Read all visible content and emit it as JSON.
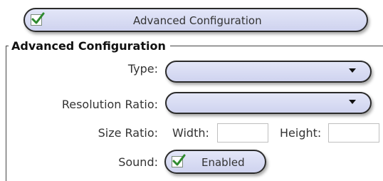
{
  "top_toggle": {
    "label": "Advanced Configuration",
    "checked": true
  },
  "section": {
    "title": "Advanced Configuration"
  },
  "fields": {
    "type": {
      "label": "Type:",
      "value": ""
    },
    "resolution": {
      "label": "Resolution Ratio:",
      "value": ""
    },
    "size": {
      "label": "Size Ratio:",
      "width_label": "Width:",
      "width_value": "",
      "height_label": "Height:",
      "height_value": ""
    },
    "sound": {
      "label": "Sound:",
      "button_label": "Enabled",
      "checked": true
    }
  }
}
